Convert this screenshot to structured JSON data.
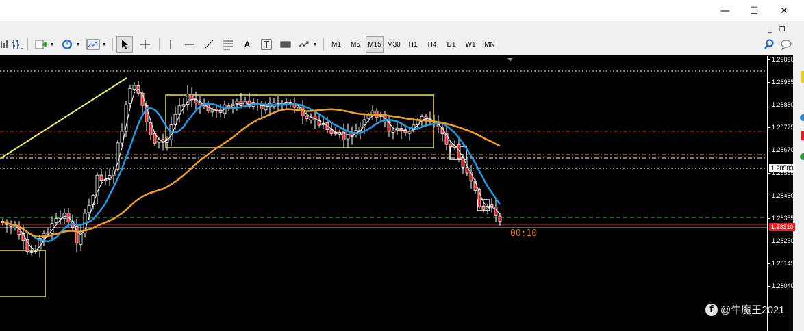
{
  "window": {
    "minimize_glyph": "—",
    "maximize_glyph": "☐",
    "close_glyph": "✕"
  },
  "mdi": {
    "minimize_glyph": "_",
    "restore_glyph": "❐",
    "close_glyph": "×"
  },
  "toolbar": {
    "timeframes": [
      "M1",
      "M5",
      "M15",
      "M30",
      "H1",
      "H4",
      "D1",
      "W1",
      "MN"
    ],
    "active_timeframe": "M15"
  },
  "price_axis": {
    "labels": [
      "1.29090",
      "1.28985",
      "1.28880",
      "1.28775",
      "1.28670",
      "1.28565",
      "1.28460",
      "1.28355",
      "1.28250",
      "1.28145",
      "1.28040"
    ],
    "bid_label": "1.28583",
    "ask_label": "1.28310"
  },
  "chart": {
    "countdown": "00:10",
    "colors": {
      "background": "#000000",
      "fast_ma": "#1e9be6",
      "slow_ma": "#f0a020",
      "rectangles": "#f0e040",
      "bull_candle": "#000000",
      "bear_candle": "#e02020"
    }
  },
  "watermark": {
    "text": "@牛魔王2021",
    "icon": "facebook-icon"
  }
}
